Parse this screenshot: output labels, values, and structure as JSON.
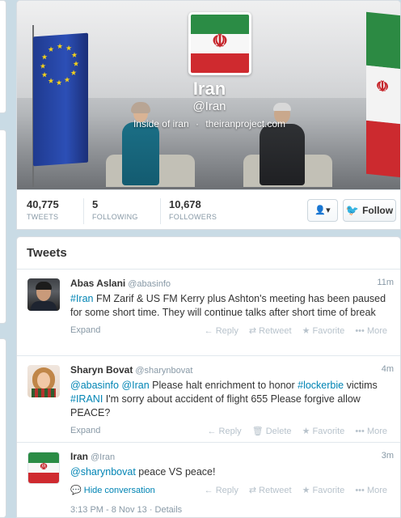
{
  "profile": {
    "name": "Iran",
    "handle": "@Iran",
    "bio": "Inside of iran",
    "separator": "·",
    "url": "theiranproject.com",
    "flag_colors": {
      "green": "#2b8c45",
      "white": "#f7f7f7",
      "red": "#cf2a2f"
    },
    "emblem_glyph": "☫"
  },
  "stats": [
    {
      "value": "40,775",
      "label": "TWEETS"
    },
    {
      "value": "5",
      "label": "FOLLOWING"
    },
    {
      "value": "10,678",
      "label": "FOLLOWERS"
    }
  ],
  "actions": {
    "user_dropdown_icon": "user-icon",
    "user_dropdown_glyph": "👤▾",
    "follow_label": "Follow",
    "follow_icon": "twitter-bird-icon",
    "follow_glyph": "🐦"
  },
  "tweets_header": "Tweets",
  "tweets": [
    {
      "fullname": "Abas Aslani",
      "username": "@abasinfo",
      "time": "11m",
      "text_parts": [
        {
          "t": "#Iran",
          "link": true
        },
        {
          "t": " FM Zarif & US FM Kerry plus Ashton's meeting has been paused for some short time. They will continue talks after short time of break",
          "link": false
        }
      ],
      "footer_left": "Expand",
      "actions": [
        "← Reply",
        "⇄ Retweet",
        "★ Favorite",
        "••• More"
      ]
    },
    {
      "fullname": "Sharyn Bovat",
      "username": "@sharynbovat",
      "time": "4m",
      "text_parts": [
        {
          "t": "@abasinfo",
          "link": true
        },
        {
          "t": " ",
          "link": false
        },
        {
          "t": "@Iran",
          "link": true
        },
        {
          "t": " Please halt enrichment to honor ",
          "link": false
        },
        {
          "t": "#lockerbie",
          "link": true
        },
        {
          "t": " victims ",
          "link": false
        },
        {
          "t": "#IRANI",
          "link": true
        },
        {
          "t": " I'm sorry about accident of flight 655 Please forgive allow PEACE?",
          "link": false
        }
      ],
      "footer_left": "Expand",
      "actions": [
        "← Reply",
        "🗑 Delete",
        "★ Favorite",
        "••• More"
      ]
    },
    {
      "fullname": "Iran",
      "username": "@Iran",
      "time": "3m",
      "text_parts": [
        {
          "t": "@sharynbovat",
          "link": true
        },
        {
          "t": " peace VS peace!",
          "link": false
        }
      ],
      "footer_left": "💬 Hide conversation",
      "actions": [
        "← Reply",
        "⇄ Retweet",
        "★ Favorite",
        "••• More"
      ],
      "timestamp_detail": "3:13 PM - 8 Nov 13 · Details"
    }
  ]
}
